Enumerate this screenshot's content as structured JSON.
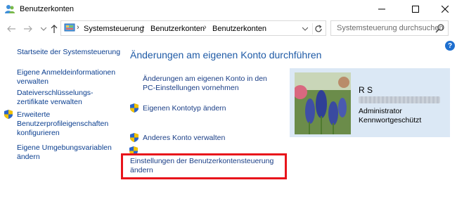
{
  "window": {
    "title": "Benutzerkonten"
  },
  "breadcrumbs": [
    "Systemsteuerung",
    "Benutzerkonten",
    "Benutzerkonten"
  ],
  "search": {
    "placeholder": "Systemsteuerung durchsuchen"
  },
  "sidebar": {
    "items": [
      {
        "label_lines": [
          "Startseite der Systemsteuerung"
        ],
        "shield": false
      },
      {
        "label_lines": [
          "Eigene Anmeldeinformationen",
          "verwalten"
        ],
        "shield": false
      },
      {
        "label_lines": [
          "Dateiverschlüsselungs-",
          "zertifikate verwalten"
        ],
        "shield": false
      },
      {
        "label_lines": [
          "Erweiterte",
          "Benutzerprofileigenschaften",
          "konfigurieren"
        ],
        "shield": true
      },
      {
        "label_lines": [
          "Eigene Umgebungsvariablen",
          "ändern"
        ],
        "shield": false
      }
    ]
  },
  "main": {
    "title": "Änderungen am eigenen Konto durchführen",
    "links": [
      {
        "label_lines": [
          "Änderungen am eigenen Konto in den",
          "PC-Einstellungen vornehmen"
        ],
        "shield": false
      },
      {
        "label_lines": [
          "Eigenen Kontotyp ändern"
        ],
        "shield": true
      },
      {
        "label_lines": [
          "Anderes Konto verwalten"
        ],
        "shield": true
      },
      {
        "label_lines": [
          "Einstellungen der Benutzerkontensteuerung",
          "ändern"
        ],
        "shield": true
      }
    ]
  },
  "account": {
    "name": "R S",
    "role": "Administrator",
    "password_status": "Kennwortgeschützt"
  },
  "colors": {
    "link": "#1a3e86",
    "title": "#1e5aa6",
    "panel": "#dbe8f5",
    "highlight": "#e8141b"
  },
  "icons": {
    "app": "user-accounts-icon",
    "back": "back-arrow-icon",
    "forward": "forward-arrow-icon",
    "up": "up-arrow-icon",
    "refresh": "refresh-icon",
    "search": "search-icon",
    "help": "help-icon",
    "shield": "uac-shield-icon"
  }
}
